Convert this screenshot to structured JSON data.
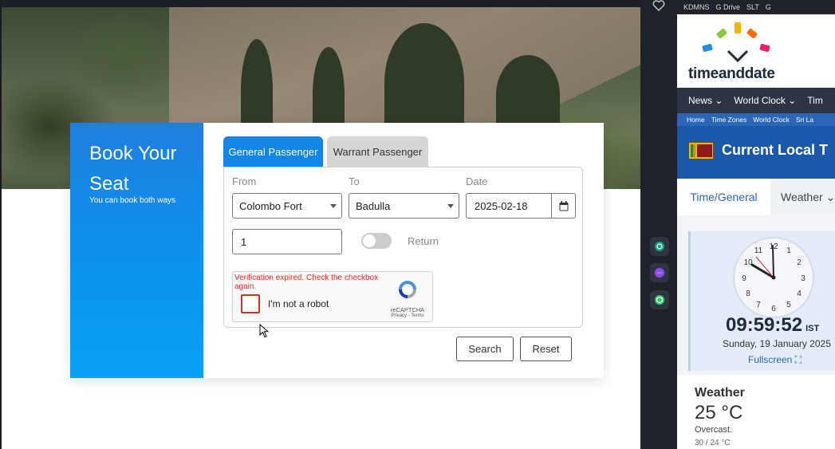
{
  "booking": {
    "title": "Book Your Seat",
    "subtitle": "You can book both ways",
    "tabs": [
      {
        "label": "General Passenger",
        "active": true
      },
      {
        "label": "Warrant Passenger",
        "active": false
      }
    ],
    "from_label": "From",
    "to_label": "To",
    "date_label": "Date",
    "from_value": "Colombo Fort",
    "to_value": "Badulla",
    "date_value": "2025-02-18",
    "passengers_value": "1",
    "return_label": "Return",
    "return_on": false,
    "search_label": "Search",
    "reset_label": "Reset"
  },
  "captcha": {
    "error": "Verification expired. Check the checkbox again.",
    "label": "I'm not a robot",
    "brand": "reCAPTCHA",
    "links": "Privacy - Terms"
  },
  "browser": {
    "bookmarks": [
      "KDMNS",
      "G Drive",
      "SLT",
      "G"
    ]
  },
  "timeanddate": {
    "logo": "timeanddate",
    "nav": [
      "News",
      "World Clock",
      "Tim"
    ],
    "breadcrumbs": [
      "Home",
      "Time Zones",
      "World Clock",
      "Sri La"
    ],
    "title": "Current Local T",
    "tabs": [
      "Time/General",
      "Weather"
    ],
    "clock_numbers": [
      "12",
      "1",
      "2",
      "3",
      "4",
      "5",
      "6",
      "7",
      "8",
      "9",
      "10",
      "11"
    ],
    "time": "09:59:52",
    "tz": "IST",
    "date": "Sunday, 19 January 2025",
    "fullscreen": "Fullscreen",
    "weather_title": "Weather",
    "weather_temp": "25 °C",
    "weather_desc": "Overcast.",
    "weather_range": "30 / 24 °C"
  },
  "colors": {
    "accent": "#1286e6",
    "error": "#d93025",
    "tad_blue": "#1a58aa"
  }
}
